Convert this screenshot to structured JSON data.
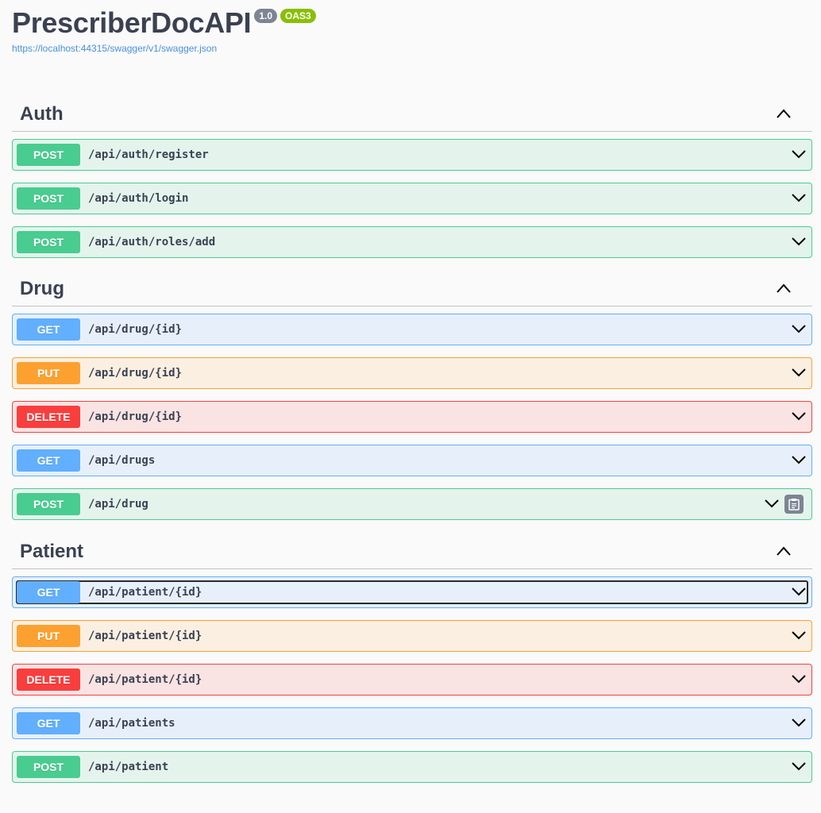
{
  "info": {
    "title": "PrescriberDocAPI",
    "version": "1.0",
    "oas": "OAS3",
    "url": "https://localhost:44315/swagger/v1/swagger.json"
  },
  "tags": [
    {
      "name": "Auth",
      "operations": [
        {
          "method": "POST",
          "path": "/api/auth/register"
        },
        {
          "method": "POST",
          "path": "/api/auth/login"
        },
        {
          "method": "POST",
          "path": "/api/auth/roles/add"
        }
      ]
    },
    {
      "name": "Drug",
      "operations": [
        {
          "method": "GET",
          "path": "/api/drug/{id}"
        },
        {
          "method": "PUT",
          "path": "/api/drug/{id}"
        },
        {
          "method": "DELETE",
          "path": "/api/drug/{id}"
        },
        {
          "method": "GET",
          "path": "/api/drugs"
        },
        {
          "method": "POST",
          "path": "/api/drug"
        }
      ]
    },
    {
      "name": "Patient",
      "operations": [
        {
          "method": "GET",
          "path": "/api/patient/{id}"
        },
        {
          "method": "PUT",
          "path": "/api/patient/{id}"
        },
        {
          "method": "DELETE",
          "path": "/api/patient/{id}"
        },
        {
          "method": "GET",
          "path": "/api/patients"
        },
        {
          "method": "POST",
          "path": "/api/patient"
        }
      ]
    }
  ],
  "icons": {
    "tag_toggle": "chevron-up-icon",
    "op_toggle": "chevron-down-icon",
    "copy": "clipboard-icon"
  },
  "colors": {
    "post": "#49cc90",
    "get": "#61affe",
    "put": "#fca130",
    "delete": "#f93e3e",
    "badge_version": "#7d8492",
    "badge_oas": "#89bf04",
    "link": "#4990e2"
  }
}
